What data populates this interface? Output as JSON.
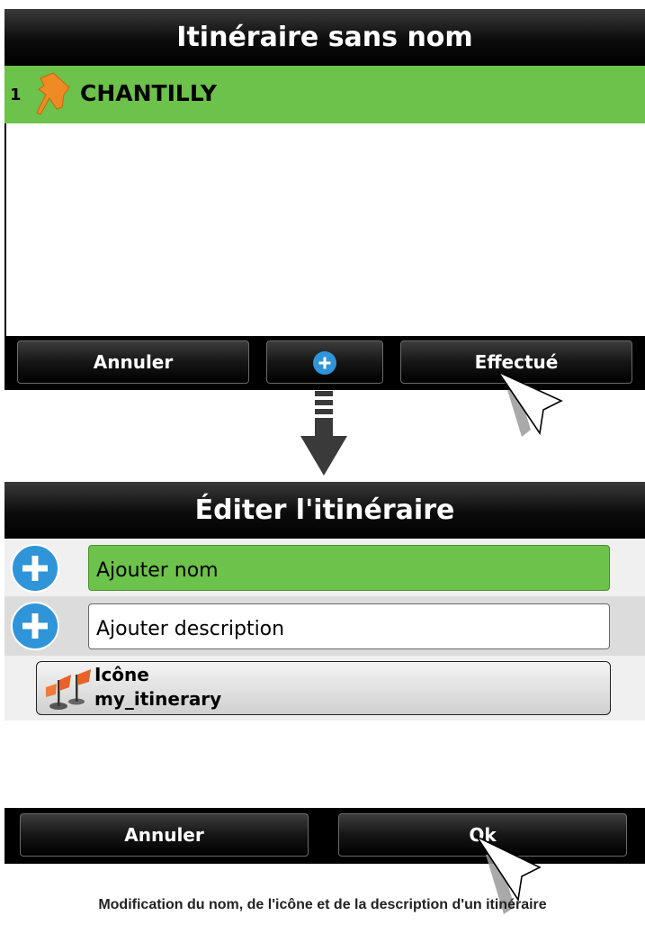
{
  "screen1": {
    "title": "Itinéraire sans nom",
    "items": [
      {
        "index": "1",
        "icon": "pushpin-icon",
        "name": "CHANTILLY"
      }
    ],
    "buttons": {
      "cancel": "Annuler",
      "add_icon": "plus-icon",
      "done": "Effectué"
    }
  },
  "screen2": {
    "title": "Éditer l'itinéraire",
    "name_field": {
      "value": "Ajouter nom"
    },
    "description_field": {
      "value": "Ajouter description"
    },
    "icon_row": {
      "label": "Icône",
      "value": "my_itinerary",
      "icon": "flags-icon"
    },
    "buttons": {
      "cancel": "Annuler",
      "ok": "Ok"
    }
  },
  "caption": "Modification du nom, de l'icône et de la description d'un itinéraire",
  "colors": {
    "accent_green": "#6cc24a",
    "plus_blue": "#2f95d8"
  }
}
